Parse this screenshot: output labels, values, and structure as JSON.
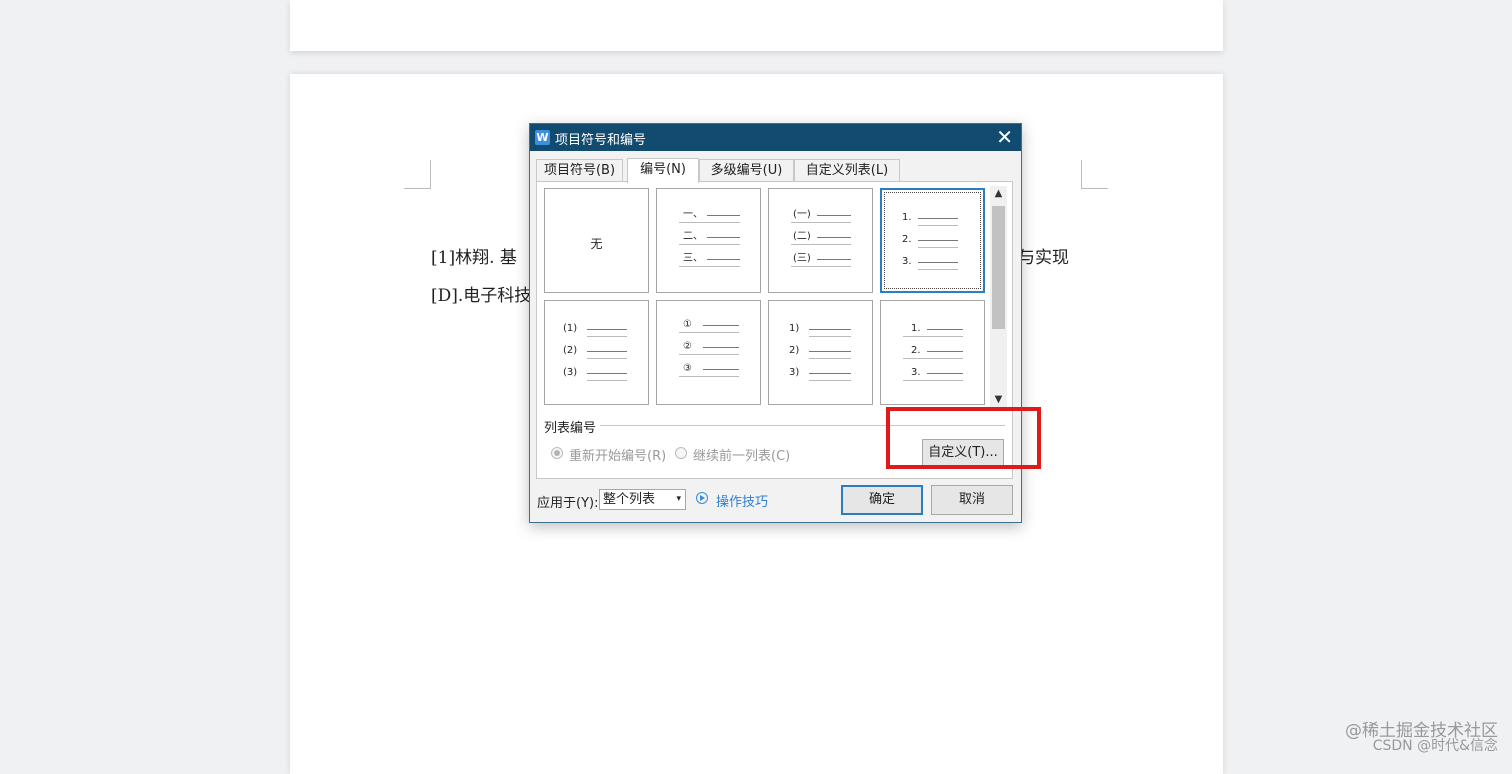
{
  "document": {
    "line1": "[1]林翔. 基",
    "line1_right": "与实现",
    "line2": "[D].电子科技"
  },
  "dialog": {
    "title": "项目符号和编号",
    "app_icon": "W",
    "close": "✕",
    "tabs": [
      {
        "label": "项目符号(B)"
      },
      {
        "label": "编号(N)"
      },
      {
        "label": "多级编号(U)"
      },
      {
        "label": "自定义列表(L)"
      }
    ],
    "active_tab": "编号(N)",
    "cells": [
      {
        "none_label": "无"
      },
      {
        "markers": [
          "一、",
          "二、",
          "三、"
        ]
      },
      {
        "markers": [
          "(一)",
          "(二)",
          "(三)"
        ]
      },
      {
        "markers": [
          "1.",
          "2.",
          "3."
        ]
      },
      {
        "markers": [
          "(1)",
          "(2)",
          "(3)"
        ]
      },
      {
        "markers": [
          "①",
          "②",
          "③"
        ]
      },
      {
        "markers": [
          "1)",
          "2)",
          "3)"
        ]
      },
      {
        "markers": [
          "1.",
          "2.",
          "3."
        ]
      }
    ],
    "selected_cell": 3,
    "scroll_up": "▲",
    "scroll_down": "▼",
    "list_numbering": {
      "section_label": "列表编号",
      "restart_label": "重新开始编号(R)",
      "continue_label": "继续前一列表(C)",
      "custom_button": "自定义(T)..."
    },
    "apply_to": {
      "label": "应用于(Y):",
      "value": "整个列表",
      "arrow": "▾"
    },
    "tips_label": "操作技巧",
    "ok_label": "确定",
    "cancel_label": "取消",
    "highlight_color": "#e01a1a",
    "title_bar_color": "#124b70"
  },
  "watermark": {
    "line1": "@稀土掘金技术社区",
    "line2": "CSDN @时代&信念"
  }
}
